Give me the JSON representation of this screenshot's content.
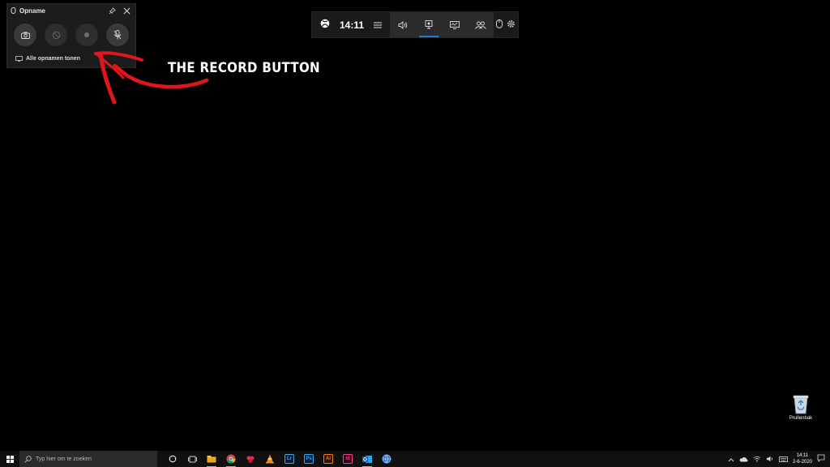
{
  "capture": {
    "title": "Opname",
    "show_all_label": "Alle opnamen tonen",
    "buttons": [
      "screenshot-button",
      "record-last-button",
      "record-button",
      "mic-button"
    ]
  },
  "gamebar": {
    "clock": "14:11",
    "icons": [
      "xbox-icon",
      "menu-icon",
      "audio-icon",
      "capture-icon",
      "performance-icon",
      "xbox-social-icon",
      "mouse-icon",
      "settings-icon"
    ]
  },
  "annotation": {
    "text": "THE RECORD BUTTON",
    "color": "#e0161b"
  },
  "desktop": {
    "recycle_label": "Prullenbak"
  },
  "taskbar": {
    "search_placeholder": "Typ hier om te zoeken",
    "time": "14:11",
    "date": "2-6-2020",
    "apps": [
      "file-explorer",
      "chrome",
      "paint",
      "vlc",
      "lightroom",
      "photoshop",
      "illustrator",
      "indesign",
      "outlook",
      "globe"
    ],
    "app_labels": {
      "lr": "Lr",
      "ps": "Ps",
      "ai": "Ai",
      "id": "Id"
    }
  }
}
